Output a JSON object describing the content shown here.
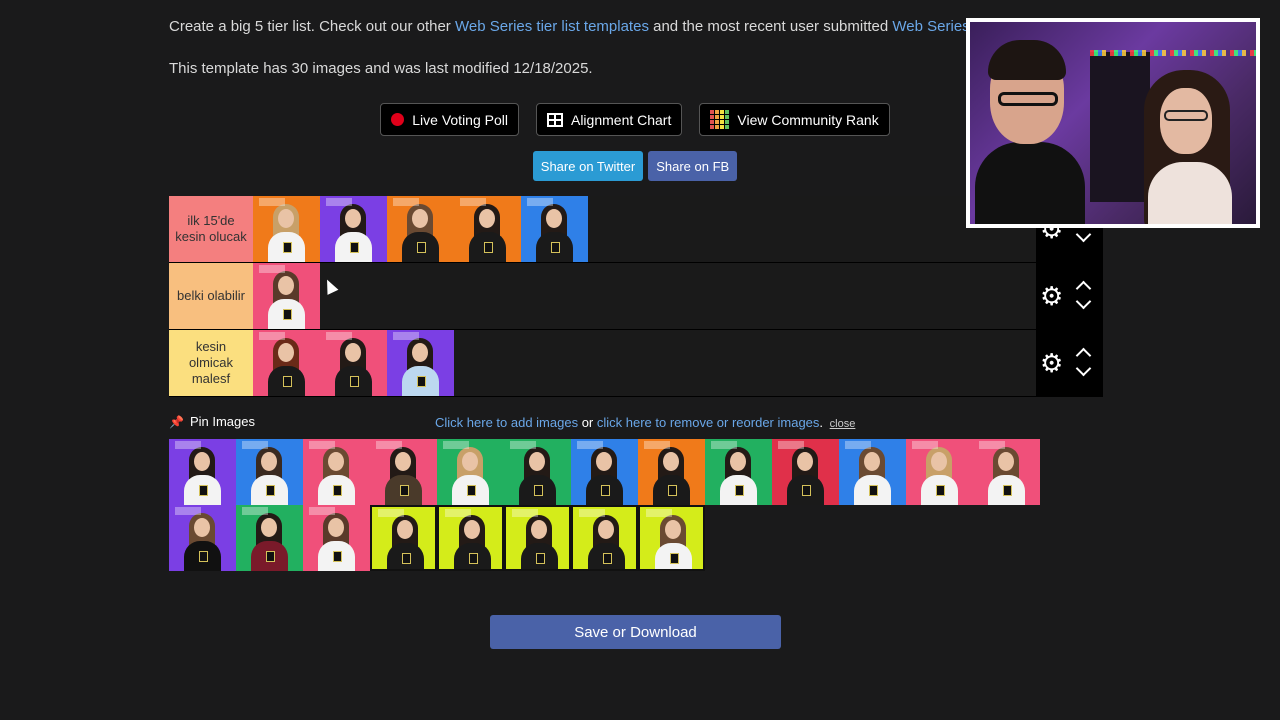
{
  "intro": {
    "text1": "Create a big 5 tier list. Check out our other ",
    "link1": "Web Series tier list templates",
    "text2": " and the most recent user submitted ",
    "link2": "Web Series tier lis"
  },
  "meta": "This template has 30 images and was last modified 12/18/2025.",
  "buttons": {
    "live_voting": "Live Voting Poll",
    "alignment": "Alignment Chart",
    "community": "View Community Rank"
  },
  "share": {
    "twitter": "Share on Twitter",
    "fb": "Share on FB"
  },
  "tiers": [
    {
      "label": "ilk 15'de kesin olucak",
      "color": "#f47f7f",
      "count": 5
    },
    {
      "label": "belki olabilir",
      "color": "#f8bf7f",
      "count": 1
    },
    {
      "label": "kesin olmicak malesf",
      "color": "#fbdf7f",
      "count": 3
    }
  ],
  "pin": {
    "label": "Pin Images",
    "add_link": "Click here to add images",
    "or": " or ",
    "remove_link": "click here to remove or reorder images",
    "dot": ".",
    "close": "close"
  },
  "pool_count": 21,
  "save_label": "Save or Download",
  "colors": {
    "purple": "#7b3fe4",
    "blue": "#2f80e8",
    "orange": "#f07a1a",
    "pink": "#f0507a",
    "green": "#22b060",
    "red": "#e0304a",
    "lime": "#d4ec1a"
  }
}
